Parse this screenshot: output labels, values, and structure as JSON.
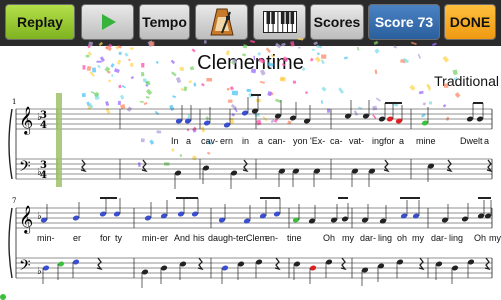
{
  "toolbar": {
    "replay_label": "Replay",
    "play_icon": "play-icon",
    "tempo_label": "Tempo",
    "metronome_icon": "metronome-icon",
    "piano_icon": "piano-keyboard-icon",
    "scores_label": "Scores",
    "score_label": "Score 73",
    "done_label": "DONE"
  },
  "sheet": {
    "title": "Clementime",
    "composer": "Traditional",
    "measure_numbers": [
      "1",
      "7"
    ],
    "time_signature": "3/4",
    "key_signature": "F major (1 flat)",
    "lyrics_line1": [
      "In",
      "a",
      "cav-",
      "ern",
      "in",
      "a",
      "can-",
      "yon",
      "'Ex-",
      "ca-",
      "vat-",
      "ing",
      "for",
      "a",
      "mine",
      "Dwelt",
      "a"
    ],
    "lyrics_line2": [
      "min-",
      "er",
      "for",
      "ty",
      "min-",
      "er",
      "And",
      "his",
      "daugh-ter",
      "Clem-",
      "en-",
      "tine",
      "Oh",
      "my",
      "dar-",
      "ling",
      "oh",
      "my",
      "dar-",
      "ling",
      "Oh",
      "my"
    ]
  },
  "colors": {
    "toolbar_bg": "#2b2b2b",
    "note_played": "#3a4fd0",
    "note_correct": "#3cbf3c",
    "note_wrong": "#e02020",
    "cursor": "#9dc26b",
    "score_button": "#3a6fb0",
    "done_button": "#f5a623"
  }
}
